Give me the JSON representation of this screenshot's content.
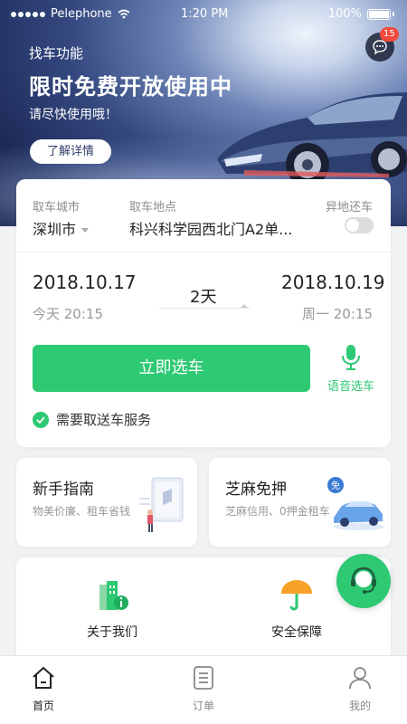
{
  "status_bar": {
    "carrier": "Pelephone",
    "time": "1:20 PM",
    "battery": "100%"
  },
  "banner": {
    "subtitle": "找车功能",
    "title": "限时免费开放使用中",
    "desc": "请尽快使用哦！",
    "button_label": "了解详情",
    "message_badge": "15"
  },
  "booking": {
    "city_label": "取车城市",
    "city_value": "深圳市",
    "location_label": "取车地点",
    "location_value": "科兴科学园西北门A2单...",
    "return_label": "异地还车",
    "return_enabled": false,
    "pickup_date": "2018.10.17",
    "pickup_time": "今天 20:15",
    "duration": "2天",
    "return_date": "2018.10.19",
    "return_time": "周一 20:15",
    "select_button": "立即选车",
    "voice_label": "语音选车",
    "delivery_label": "需要取送车服务",
    "delivery_checked": true
  },
  "features": [
    {
      "title": "新手指南",
      "desc": "物美价廉、租车省钱"
    },
    {
      "title": "芝麻免押",
      "desc": "芝麻信用、0押金租车",
      "badge": "免"
    }
  ],
  "links": [
    {
      "label": "关于我们",
      "icon": "building-info-icon"
    },
    {
      "label": "安全保障",
      "icon": "umbrella-icon"
    }
  ],
  "tabs": [
    {
      "label": "首页",
      "icon": "home-icon",
      "active": true
    },
    {
      "label": "订单",
      "icon": "order-list-icon",
      "active": false
    },
    {
      "label": "我的",
      "icon": "user-icon",
      "active": false
    }
  ],
  "colors": {
    "accent_green": "#2dc973",
    "badge_red": "#f24a3c",
    "banner_navy": "#1d2a58"
  }
}
